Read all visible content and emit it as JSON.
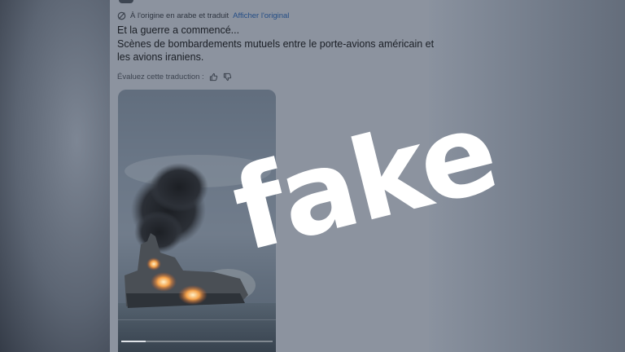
{
  "tweet": {
    "translation_note": "À l'origine en arabe et traduit",
    "show_original_label": "Afficher l'original",
    "text_lines": [
      "Et la guerre a commencé...",
      "Scènes de bombardements mutuels entre le porte-avions américain et",
      "les avions iraniens."
    ],
    "rate_translation_label": "Évaluez cette traduction :",
    "icons": {
      "translate": "translate-icon",
      "thumbs_up": "thumbs-up-icon",
      "thumbs_down": "thumbs-down-icon"
    }
  },
  "video": {
    "description_icon": "warship-explosion-image",
    "progress_fraction": 0.16
  },
  "overlay": {
    "label": "fake",
    "color": "#ffffff"
  }
}
